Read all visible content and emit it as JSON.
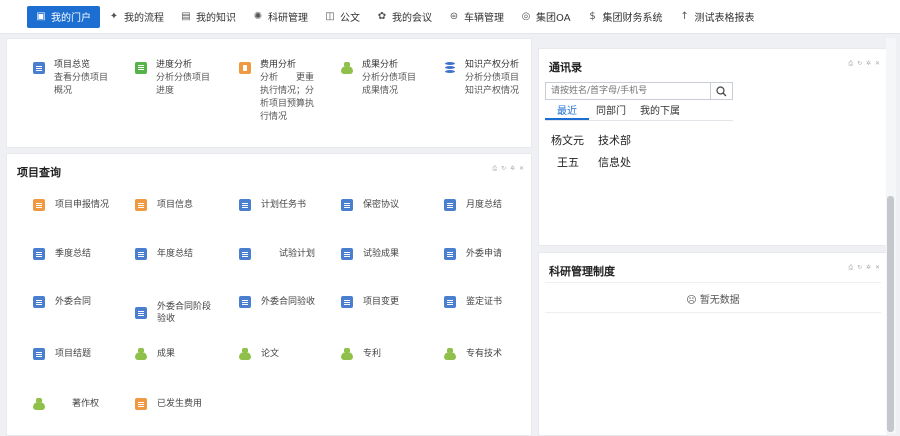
{
  "nav": {
    "items": [
      {
        "label": "我的门户",
        "icon": "portal-icon",
        "active": true
      },
      {
        "label": "我的流程",
        "icon": "flow-icon"
      },
      {
        "label": "我的知识",
        "icon": "book-icon"
      },
      {
        "label": "科研管理",
        "icon": "gear-icon"
      },
      {
        "label": "公文",
        "icon": "briefcase-icon"
      },
      {
        "label": "我的会议",
        "icon": "meeting-icon"
      },
      {
        "label": "车辆管理",
        "icon": "car-icon"
      },
      {
        "label": "集团OA",
        "icon": "globe-icon"
      },
      {
        "label": "集团财务系统",
        "icon": "money-icon"
      },
      {
        "label": "测试表格报表",
        "icon": "arrow-up-icon"
      }
    ]
  },
  "summary": {
    "items": [
      {
        "lines": [
          "项目总览",
          "查看分债项目",
          "概况"
        ],
        "icon": "doc-icon"
      },
      {
        "lines": [
          "进度分析",
          "分析分债项目",
          "进度"
        ],
        "icon": "progress-icon"
      },
      {
        "lines": [
          "费用分析",
          "分析　　更重",
          "执行情况；分",
          "析项目预算执",
          "行情况"
        ],
        "icon": "expense-icon"
      },
      {
        "lines": [
          "成果分析",
          "分析分债项目",
          "成果情况"
        ],
        "icon": "bag-icon"
      },
      {
        "lines": [
          "知识产权分析",
          "分析分债项目",
          "知识产权情况"
        ],
        "icon": "database-icon"
      }
    ]
  },
  "project_query": {
    "title": "项目查询",
    "tools": "⎙ ↻ ✲ ✕",
    "items": [
      {
        "label": "项目申报情况",
        "icon": "orange-doc-icon"
      },
      {
        "label": "项目信息",
        "icon": "orange-doc-icon"
      },
      {
        "label": "计划任务书",
        "icon": "doc-icon"
      },
      {
        "label": "保密协议",
        "icon": "doc-icon"
      },
      {
        "label": "月度总结",
        "icon": "doc-icon"
      },
      {
        "label": "季度总结",
        "icon": "doc-icon"
      },
      {
        "label": "年度总结",
        "icon": "doc-icon"
      },
      {
        "label": "试验计划",
        "icon": "doc-icon"
      },
      {
        "label": "试验成果",
        "icon": "doc-icon"
      },
      {
        "label": "外委申请",
        "icon": "doc-icon"
      },
      {
        "label": "外委合同",
        "icon": "doc-icon"
      },
      {
        "label": "外委合同阶段验收",
        "icon": "doc-icon"
      },
      {
        "label": "外委合同验收",
        "icon": "doc-icon"
      },
      {
        "label": "项目变更",
        "icon": "doc-icon"
      },
      {
        "label": "鉴定证书",
        "icon": "doc-icon"
      },
      {
        "label": "项目结题",
        "icon": "doc-icon"
      },
      {
        "label": "成果",
        "icon": "bag-icon"
      },
      {
        "label": "论文",
        "icon": "bag-icon"
      },
      {
        "label": "专利",
        "icon": "bag-icon"
      },
      {
        "label": "专有技术",
        "icon": "bag-icon"
      },
      {
        "label": "著作权",
        "icon": "bag-icon"
      },
      {
        "label": "已发生费用",
        "icon": "orange-doc-icon"
      }
    ]
  },
  "contacts": {
    "title": "通讯录",
    "tools": "⎙ ↻ ✲ ✕",
    "search_placeholder": "请按姓名/首字母/手机号",
    "tabs": [
      {
        "label": "最近",
        "active": true
      },
      {
        "label": "同部门"
      },
      {
        "label": "我的下属"
      }
    ],
    "list": [
      {
        "name": "杨文元",
        "dept": "技术部"
      },
      {
        "name": "王五",
        "dept": "信息处"
      }
    ]
  },
  "rules": {
    "title": "科研管理制度",
    "tools": "⎙ ↻ ✲ ✕",
    "empty_text": "暂无数据"
  },
  "colors": {
    "accent": "#1c6fd1"
  }
}
